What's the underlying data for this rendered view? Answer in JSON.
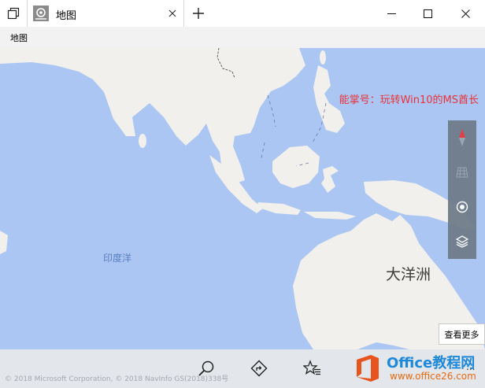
{
  "window": {
    "tab_title": "地图",
    "icons": {
      "tab_list": "tab-list-icon",
      "app": "maps-app-icon",
      "close_tab": "close-icon",
      "new_tab": "plus-icon",
      "minimize": "minimize-icon",
      "maximize": "maximize-icon",
      "close": "close-icon"
    }
  },
  "app_header": {
    "label": "地图"
  },
  "map": {
    "watermark": "能掌号：玩转Win10的MS酋长",
    "ocean_label": "印度洋",
    "region_label": "大洋洲",
    "controls": [
      "compass-icon",
      "3d-buildings-icon",
      "location-icon",
      "layers-icon"
    ],
    "see_more": "查看更多",
    "colors": {
      "water": "#abc6f2",
      "land": "#f1f0ec",
      "control_panel": "#6e7a88",
      "compass_needle": "#e8333a"
    }
  },
  "bottom_bar": {
    "copyright": "© 2018 Microsoft Corporation, © 2018 NavInfo GS(2018)338号",
    "buttons": [
      "search-icon",
      "directions-icon",
      "favorites-icon"
    ],
    "more": "..."
  },
  "brand": {
    "name": "Office教程网",
    "url": "www.office26.com",
    "colors": {
      "name": "#1e88d9",
      "url": "#e86a12",
      "logo": "#e8541e"
    }
  }
}
